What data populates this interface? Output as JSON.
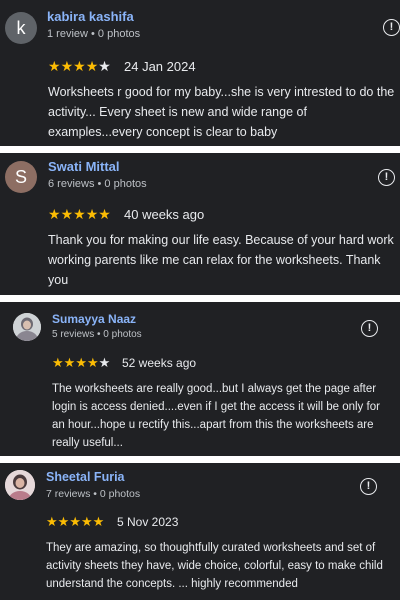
{
  "reviews": [
    {
      "avatar_letter": "k",
      "avatar_color": "#5f6368",
      "name": "kabira kashifa",
      "meta": "1 review • 0 photos",
      "rating": 4,
      "date": "24 Jan 2024",
      "text": "Worksheets r good for my baby...she is very intrested to do the activity... Every sheet is new and wide range of examples...every concept is clear to baby"
    },
    {
      "avatar_letter": "S",
      "avatar_color": "#8d6e63",
      "name": "Swati Mittal",
      "meta": "6 reviews • 0 photos",
      "rating": 5,
      "date": "40 weeks ago",
      "text": "Thank you for making our life easy. Because of your hard work working parents like me can relax for the worksheets. Thank you"
    },
    {
      "avatar_letter": "",
      "avatar_color": "#9aa0a6",
      "name": "Sumayya Naaz",
      "meta": "5 reviews • 0 photos",
      "rating": 4,
      "date": "52 weeks ago",
      "text": "The worksheets are really good...but I always get the page after login is access denied....even if I get the access it will be only for an hour...hope u rectify this...apart from this the worksheets are really useful..."
    },
    {
      "avatar_letter": "",
      "avatar_color": "#c9a9b0",
      "name": "Sheetal Furia",
      "meta": "7 reviews • 0 photos",
      "rating": 5,
      "date": "5 Nov 2023",
      "text": "They are amazing, so thoughtfully curated worksheets and set of activity sheets they have, wide choice, colorful, easy to make child understand the concepts. ... highly recommended"
    }
  ]
}
